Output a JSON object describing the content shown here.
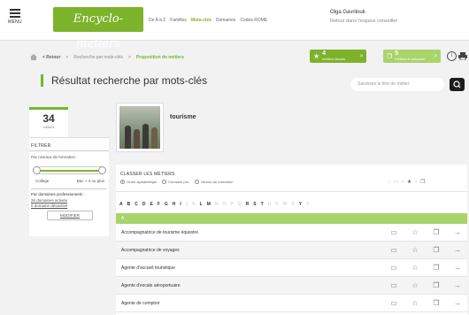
{
  "header": {
    "menu_label": "MENU",
    "logo": "Encyclo-métiers",
    "nav": [
      "De A à Z",
      "Familles",
      "Mots-clés",
      "Domaines",
      "Codes ROME"
    ],
    "nav_active": "Mots-clés",
    "user_name": "Olga Gavrilouk",
    "user_link": "Retour dans l'espace conseiller"
  },
  "breadcrumb": {
    "back": "< Retour",
    "sep1": ">",
    "crumb1": "Recherche par mots-clés",
    "sep2": ">",
    "crumb2": "Proposition de métiers"
  },
  "favorites": {
    "count": "4",
    "label": "métiers favoris",
    "arrow": ">"
  },
  "compare": {
    "count": "5",
    "label": "métiers à comparer",
    "arrow": ">"
  },
  "help_icon": "i",
  "title": "Résultat recherche par mots-clés",
  "search": {
    "placeholder": "Saisissez le titre de métier"
  },
  "left": {
    "count": "34",
    "count_label": "métiers",
    "filter_title": "FILTRER",
    "level_label": "Par niveaux de formation :",
    "slider_min": "Collège",
    "slider_max": "Bac + 4 ou plus",
    "slider_range": [
      0,
      1
    ],
    "domain_label": "Par domaines professionnels :",
    "domains_active": "26 domaines activés",
    "domains_inactive": "0 domaine désactivé",
    "modify": "MODIFIER"
  },
  "featured": {
    "title": "tourisme"
  },
  "sort": {
    "label": "CLASSER LES MÉTIERS",
    "options": [
      "Ordre alphabétique",
      "Domaine pro.",
      "Niveau de formation"
    ],
    "selected": 0
  },
  "alphabet": [
    "A",
    "B",
    "C",
    "D",
    "E",
    "F",
    "G",
    "H",
    "I",
    "J",
    "K",
    "L",
    "M",
    "N",
    "O",
    "P",
    "Q",
    "R",
    "S",
    "T",
    "U",
    "V",
    "W",
    "X",
    "Y",
    "Z"
  ],
  "alphabet_active": [
    "A",
    "B",
    "C",
    "D",
    "E",
    "F",
    "G",
    "H",
    "I",
    "L",
    "M",
    "R",
    "S",
    "T",
    "Y"
  ],
  "group_letter": "A",
  "rows": [
    "Accompagnatrice de tourisme équestre",
    "Accompagnatrice de voyages",
    "Agente d'accueil touristique",
    "Agente d'escale aéroportuaire",
    "Agente de comptoir"
  ],
  "colors": {
    "accent": "#7cb32a",
    "accent_light": "#a9d46c",
    "dark": "#1d1d1d"
  }
}
